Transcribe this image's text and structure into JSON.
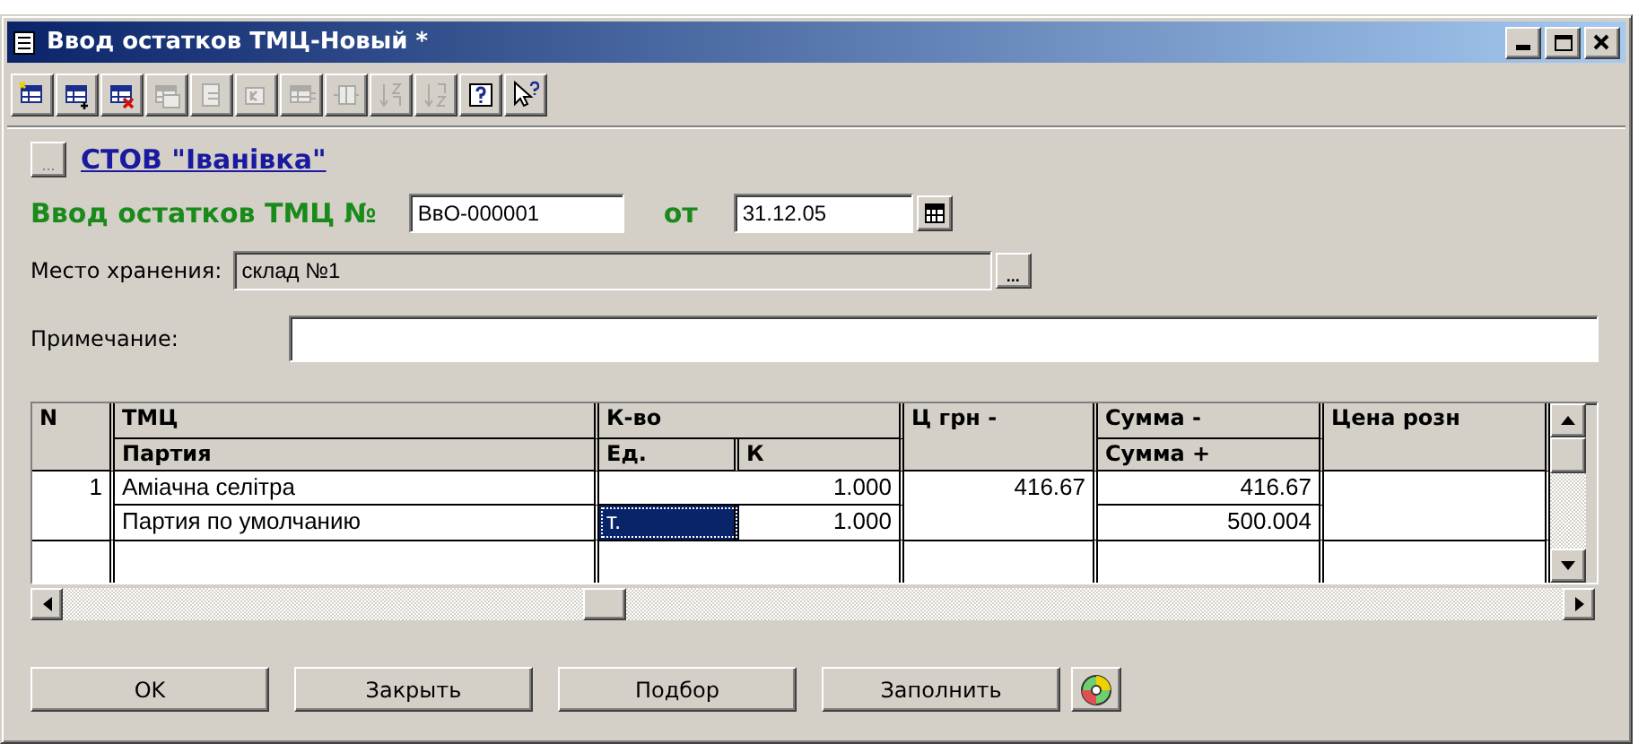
{
  "window": {
    "title": "Ввод остатков ТМЦ-Новый *"
  },
  "toolbar": [
    {
      "kind": "new",
      "disabled": false
    },
    {
      "kind": "add",
      "disabled": false
    },
    {
      "kind": "delete",
      "disabled": false
    },
    {
      "kind": "copy",
      "disabled": true
    },
    {
      "kind": "document",
      "disabled": true
    },
    {
      "kind": "ledger",
      "disabled": true
    },
    {
      "kind": "columns",
      "disabled": true
    },
    {
      "kind": "rows",
      "disabled": true
    },
    {
      "kind": "sortup",
      "disabled": true
    },
    {
      "kind": "sortdown",
      "disabled": true
    },
    {
      "kind": "help",
      "disabled": false
    },
    {
      "kind": "whatsthis",
      "disabled": false
    }
  ],
  "company": {
    "button": "...",
    "link": "СТОВ \"Іванівка\""
  },
  "document": {
    "label": "Ввод остатков ТМЦ №",
    "number": "ВвО-000001",
    "date_label": "от",
    "date": "31.12.05"
  },
  "storage": {
    "label": "Место хранения:",
    "value": "склад №1",
    "button": "..."
  },
  "note": {
    "label": "Примечание:"
  },
  "table": {
    "columns": [
      {
        "label": "N"
      },
      {
        "label": "ТМЦ",
        "sub": "Партия"
      },
      {
        "label": "К-во",
        "subs": [
          "Ед.",
          "К"
        ]
      },
      {
        "label": "Ц грн -"
      },
      {
        "label": "Сумма -",
        "sub": "Сумма +"
      },
      {
        "label": "Цена розн"
      }
    ],
    "rows": [
      {
        "number": "1",
        "item": "Аміачна селітра",
        "quantity": "1.000",
        "price": "416.67",
        "sum_minus": "416.67",
        "batch": "Партия по умолчанию",
        "unit": "т.",
        "unit_selected": true,
        "k": "1.000",
        "sum_plus": "500.004"
      }
    ]
  },
  "buttons": [
    {
      "label": "OK"
    },
    {
      "label": "Закрыть"
    },
    {
      "label": "Подбор"
    },
    {
      "label": "Заполнить"
    }
  ]
}
